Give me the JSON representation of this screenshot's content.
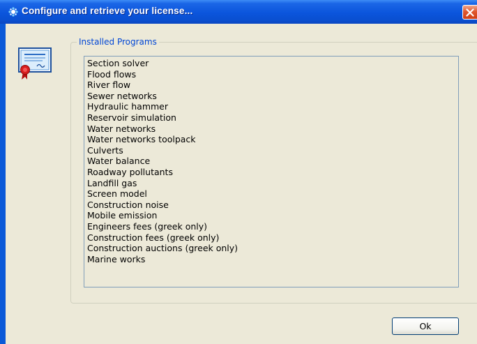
{
  "window": {
    "title": "Configure and retrieve your license...",
    "title_bar_color": "#0a54d8",
    "icons": [
      "app-icon",
      "close-icon",
      "certificate-icon"
    ]
  },
  "group": {
    "label": "Installed Programs"
  },
  "programs": [
    "Section solver",
    "Flood flows",
    "River flow",
    "Sewer networks",
    "Hydraulic hammer",
    "Reservoir simulation",
    "Water networks",
    "Water networks toolpack",
    "Culverts",
    "Water balance",
    "Roadway pollutants",
    "Landfill gas",
    "Screen model",
    "Construction noise",
    "Mobile emission",
    "Engineers fees (greek only)",
    "Construction fees (greek only)",
    "Construction auctions (greek only)",
    "Marine works"
  ],
  "buttons": {
    "ok_label": "Ok"
  }
}
